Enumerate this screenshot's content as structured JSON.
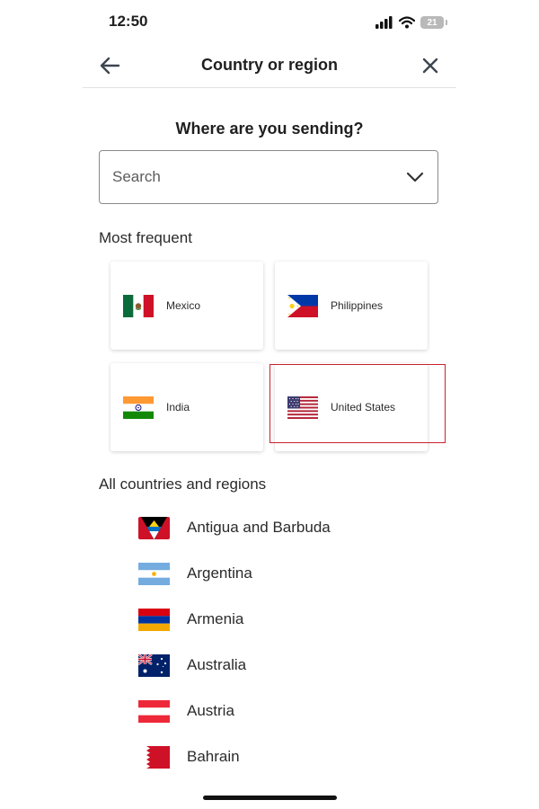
{
  "status_bar": {
    "time": "12:50",
    "battery": "21"
  },
  "header": {
    "title": "Country or region",
    "back_icon": "arrow-left-icon",
    "close_icon": "close-icon"
  },
  "prompt": "Where are you sending?",
  "search": {
    "placeholder": "Search",
    "dropdown_icon": "chevron-down-icon"
  },
  "most_frequent": {
    "title": "Most frequent",
    "items": [
      {
        "label": "Mexico",
        "flag": "mexico-flag-icon"
      },
      {
        "label": "Philippines",
        "flag": "philippines-flag-icon"
      },
      {
        "label": "India",
        "flag": "india-flag-icon"
      },
      {
        "label": "United States",
        "flag": "united-states-flag-icon",
        "highlighted": true
      }
    ]
  },
  "all_countries": {
    "title": "All countries and regions",
    "items": [
      {
        "label": "Antigua and Barbuda",
        "flag": "antigua-and-barbuda-flag-icon"
      },
      {
        "label": "Argentina",
        "flag": "argentina-flag-icon"
      },
      {
        "label": "Armenia",
        "flag": "armenia-flag-icon"
      },
      {
        "label": "Australia",
        "flag": "australia-flag-icon"
      },
      {
        "label": "Austria",
        "flag": "austria-flag-icon"
      },
      {
        "label": "Bahrain",
        "flag": "bahrain-flag-icon"
      }
    ]
  },
  "colors": {
    "highlight_border": "#c8232c",
    "text": "#1f1f1f"
  }
}
